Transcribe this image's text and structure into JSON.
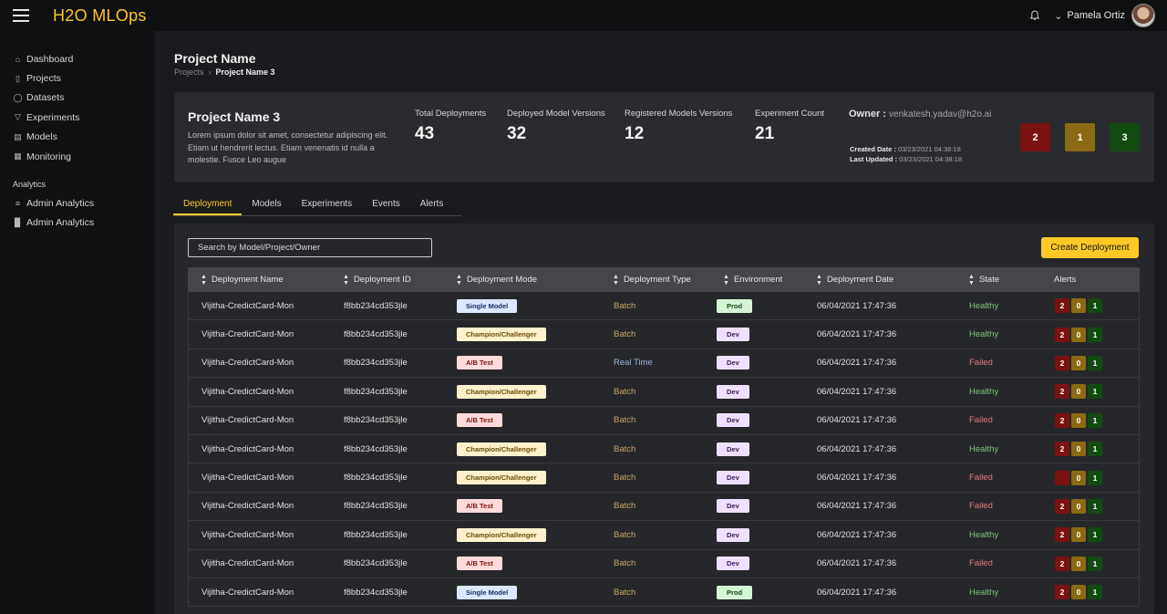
{
  "app": {
    "title": "H2O MLOps"
  },
  "user": {
    "name": "Pamela Ortiz"
  },
  "sidebar": {
    "items": [
      {
        "label": "Dashboard",
        "icon": "home-icon"
      },
      {
        "label": "Projects",
        "icon": "folder-icon"
      },
      {
        "label": "Datasets",
        "icon": "database-icon"
      },
      {
        "label": "Experiments",
        "icon": "filter-icon"
      },
      {
        "label": "Models",
        "icon": "models-icon"
      },
      {
        "label": "Monitoring",
        "icon": "monitoring-icon"
      }
    ],
    "section_label": "Analytics",
    "analytics_items": [
      {
        "label": "Admin Analytics",
        "icon": "sliders-icon"
      },
      {
        "label": "Admin Analytics",
        "icon": "bar-chart-icon"
      }
    ]
  },
  "page": {
    "title": "Project Name",
    "breadcrumb": {
      "parent": "Projects",
      "current": "Project Name 3"
    }
  },
  "summary": {
    "name": "Project Name 3",
    "description": "Lorem ipsum dolor sit amet, consectetur adipiscing elit. Etiam ut hendrerit lectus. Etiam venenatis id nulla a molestie. Fusce Leo augue",
    "stats": [
      {
        "label": "Total Deployments",
        "value": "43"
      },
      {
        "label": "Deployed Model Versions",
        "value": "32"
      },
      {
        "label": "Registered Models Versions",
        "value": "12"
      },
      {
        "label": "Experiment Count",
        "value": "21"
      }
    ],
    "owner_label": "Owner :",
    "owner_email": "venkatesh.yadav@h2o.ai",
    "created_label": "Created Date :",
    "created_value": "03/23/2021 04:38:18",
    "updated_label": "Last Updated :",
    "updated_value": "03/23/2021 04:38:18",
    "badges": [
      {
        "value": "2",
        "color": "#7a1212"
      },
      {
        "value": "1",
        "color": "#8a6a12"
      },
      {
        "value": "3",
        "color": "#124a12"
      }
    ]
  },
  "tabs": [
    "Deployment",
    "Models",
    "Experiments",
    "Events",
    "Alerts"
  ],
  "search": {
    "placeholder": "Search by Model/Project/Owner"
  },
  "create_button": "Create Deployment",
  "table": {
    "columns": [
      "Deployment Name",
      "Deployment ID",
      "Deployment Mode",
      "Deployment Type",
      "Environment",
      "Deployment Date",
      "State",
      "Alerts"
    ],
    "rows": [
      {
        "name": "Vijitha-CredictCard-Mon",
        "id": "f8bb234cd353jle",
        "mode": "Single Model",
        "type": "Batch",
        "env": "Prod",
        "date": "06/04/2021 17:47:36",
        "state": "Healthy",
        "alerts": [
          "2",
          "0",
          "1"
        ]
      },
      {
        "name": "Vijitha-CredictCard-Mon",
        "id": "f8bb234cd353jle",
        "mode": "Champion/Challenger",
        "type": "Batch",
        "env": "Dev",
        "date": "06/04/2021 17:47:36",
        "state": "Healthy",
        "alerts": [
          "2",
          "0",
          "1"
        ]
      },
      {
        "name": "Vijitha-CredictCard-Mon",
        "id": "f8bb234cd353jle",
        "mode": "A/B Test",
        "type": "Real Time",
        "env": "Dev",
        "date": "06/04/2021 17:47:36",
        "state": "Failed",
        "alerts": [
          "2",
          "0",
          "1"
        ]
      },
      {
        "name": "Vijitha-CredictCard-Mon",
        "id": "f8bb234cd353jle",
        "mode": "Champion/Challenger",
        "type": "Batch",
        "env": "Dev",
        "date": "06/04/2021 17:47:36",
        "state": "Healthy",
        "alerts": [
          "2",
          "0",
          "1"
        ]
      },
      {
        "name": "Vijitha-CredictCard-Mon",
        "id": "f8bb234cd353jle",
        "mode": "A/B Test",
        "type": "Batch",
        "env": "Dev",
        "date": "06/04/2021 17:47:36",
        "state": "Failed",
        "alerts": [
          "2",
          "0",
          "1"
        ]
      },
      {
        "name": "Vijitha-CredictCard-Mon",
        "id": "f8bb234cd353jle",
        "mode": "Champion/Challenger",
        "type": "Batch",
        "env": "Dev",
        "date": "06/04/2021 17:47:36",
        "state": "Healthy",
        "alerts": [
          "2",
          "0",
          "1"
        ]
      },
      {
        "name": "Vijitha-CredictCard-Mon",
        "id": "f8bb234cd353jle",
        "mode": "Champion/Challenger",
        "type": "Batch",
        "env": "Dev",
        "date": "06/04/2021 17:47:36",
        "state": "Failed",
        "alerts": [
          "",
          "0",
          "1"
        ]
      },
      {
        "name": "Vijitha-CredictCard-Mon",
        "id": "f8bb234cd353jle",
        "mode": "A/B Test",
        "type": "Batch",
        "env": "Dev",
        "date": "06/04/2021 17:47:36",
        "state": "Failed",
        "alerts": [
          "2",
          "0",
          "1"
        ]
      },
      {
        "name": "Vijitha-CredictCard-Mon",
        "id": "f8bb234cd353jle",
        "mode": "Champion/Challenger",
        "type": "Batch",
        "env": "Dev",
        "date": "06/04/2021 17:47:36",
        "state": "Healthy",
        "alerts": [
          "2",
          "0",
          "1"
        ]
      },
      {
        "name": "Vijitha-CredictCard-Mon",
        "id": "f8bb234cd353jle",
        "mode": "A/B Test",
        "type": "Batch",
        "env": "Dev",
        "date": "06/04/2021 17:47:36",
        "state": "Failed",
        "alerts": [
          "2",
          "0",
          "1"
        ]
      },
      {
        "name": "Vijitha-CredictCard-Mon",
        "id": "f8bb234cd353jle",
        "mode": "Single Model",
        "type": "Batch",
        "env": "Prod",
        "date": "06/04/2021 17:47:36",
        "state": "Healthy",
        "alerts": [
          "2",
          "0",
          "1"
        ]
      }
    ]
  }
}
